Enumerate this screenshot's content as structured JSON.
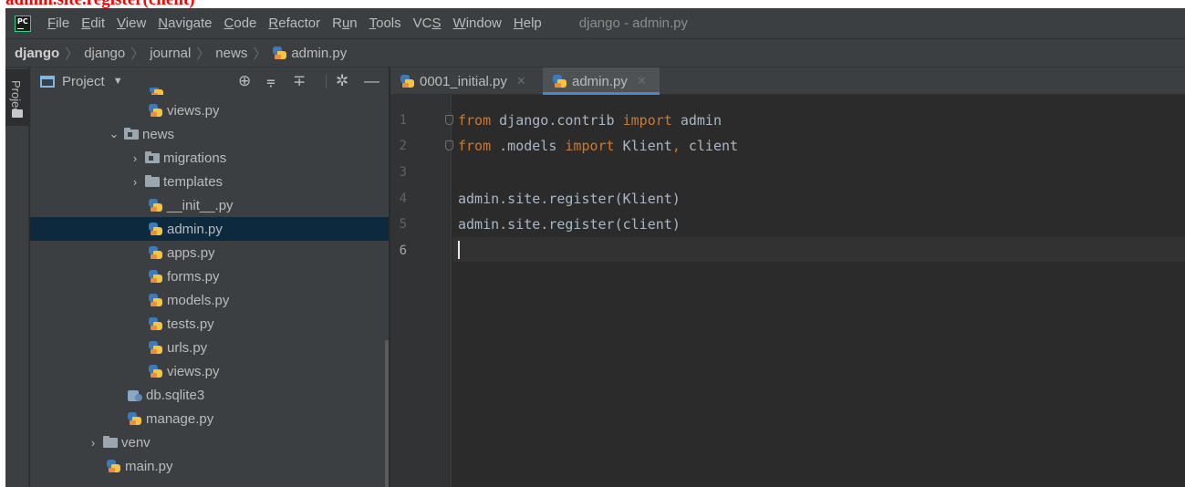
{
  "caption": "admin.site.register(client)",
  "menu": {
    "items": [
      {
        "pre": "",
        "u": "F",
        "post": "ile"
      },
      {
        "pre": "",
        "u": "E",
        "post": "dit"
      },
      {
        "pre": "",
        "u": "V",
        "post": "iew"
      },
      {
        "pre": "",
        "u": "N",
        "post": "avigate"
      },
      {
        "pre": "",
        "u": "C",
        "post": "ode"
      },
      {
        "pre": "",
        "u": "R",
        "post": "efactor"
      },
      {
        "pre": "R",
        "u": "u",
        "post": "n"
      },
      {
        "pre": "",
        "u": "T",
        "post": "ools"
      },
      {
        "pre": "VC",
        "u": "S",
        "post": ""
      },
      {
        "pre": "",
        "u": "W",
        "post": "indow"
      },
      {
        "pre": "",
        "u": "H",
        "post": "elp"
      }
    ],
    "window_title": "django - admin.py"
  },
  "breadcrumb": [
    "django",
    "django",
    "journal",
    "news",
    "admin.py"
  ],
  "toolstrip": {
    "project_label": "Project"
  },
  "project_panel": {
    "title": "Project",
    "tree": [
      {
        "label": "views.py",
        "type": "py"
      },
      {
        "label": "news",
        "type": "folder-open"
      },
      {
        "label": "migrations",
        "type": "folder-closed"
      },
      {
        "label": "templates",
        "type": "folder-closed"
      },
      {
        "label": "__init__.py",
        "type": "py"
      },
      {
        "label": "admin.py",
        "type": "py",
        "selected": true
      },
      {
        "label": "apps.py",
        "type": "py"
      },
      {
        "label": "forms.py",
        "type": "py"
      },
      {
        "label": "models.py",
        "type": "py"
      },
      {
        "label": "tests.py",
        "type": "py"
      },
      {
        "label": "urls.py",
        "type": "py"
      },
      {
        "label": "views.py",
        "type": "py"
      },
      {
        "label": "db.sqlite3",
        "type": "db"
      },
      {
        "label": "manage.py",
        "type": "py"
      },
      {
        "label": "venv",
        "type": "folder-closed"
      },
      {
        "label": "main.py",
        "type": "py"
      }
    ]
  },
  "tabs": [
    {
      "label": "0001_initial.py",
      "active": false
    },
    {
      "label": "admin.py",
      "active": true
    }
  ],
  "editor": {
    "line_numbers": [
      "1",
      "2",
      "3",
      "4",
      "5",
      "6"
    ],
    "line1": {
      "kw1": "from",
      "mid": " django.contrib ",
      "kw2": "import",
      "rest": " admin"
    },
    "line2": {
      "kw1": "from",
      "mid": " .models ",
      "kw2": "import",
      "a": " Klient",
      "comma": ",",
      "b": " client"
    },
    "line4": "admin.site.register(Klient)",
    "line5": "admin.site.register(client)",
    "current_line": 6
  },
  "colors": {
    "keyword": "#cc7832",
    "text": "#a9b7c6",
    "caption": "#ff0000",
    "selection": "#0d293e"
  }
}
